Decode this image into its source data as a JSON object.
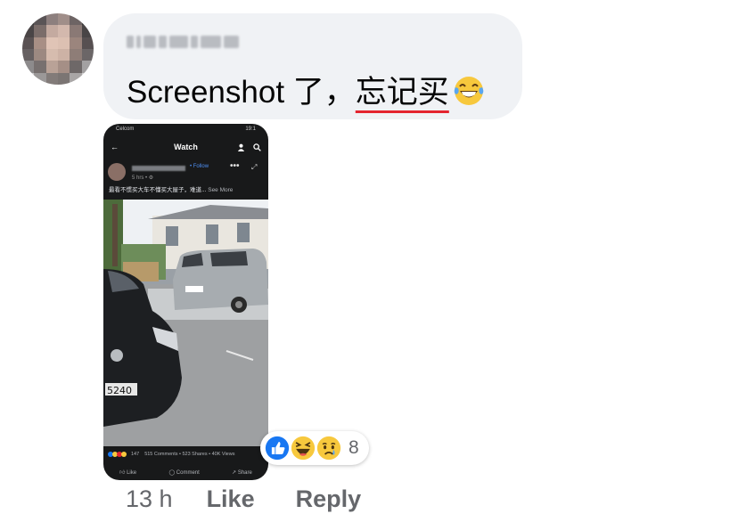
{
  "comment": {
    "author_name": "",
    "text_plain": "Screenshot 了，",
    "text_underlined": "忘记买",
    "emoji": "tears-of-joy",
    "reactions": {
      "icons": [
        "like",
        "laughing",
        "sad"
      ],
      "count": "8"
    },
    "timestamp": "13 h",
    "like_label": "Like",
    "reply_label": "Reply"
  },
  "attachment": {
    "status_bar": {
      "left": "Celcom",
      "right": "19:1"
    },
    "title": "Watch",
    "post": {
      "follow_label": "• Follow",
      "time": "5 hrs • ⚙",
      "caption": "最看不惯买大车不懂买大屋子，难道...",
      "see_more": "See More"
    },
    "plate_number": "5240",
    "stats": {
      "reaction_count": "147",
      "comments_shares_views": "515 Comments • 523 Shares • 40K Views"
    },
    "actions": {
      "like": "Like",
      "comment": "Comment",
      "share": "Share"
    }
  },
  "colors": {
    "bubble_bg": "#f0f2f5",
    "meta_text": "#65676b",
    "underline": "#e4252f",
    "like_blue": "#1877f2",
    "emoji_yellow": "#f7c83d"
  }
}
